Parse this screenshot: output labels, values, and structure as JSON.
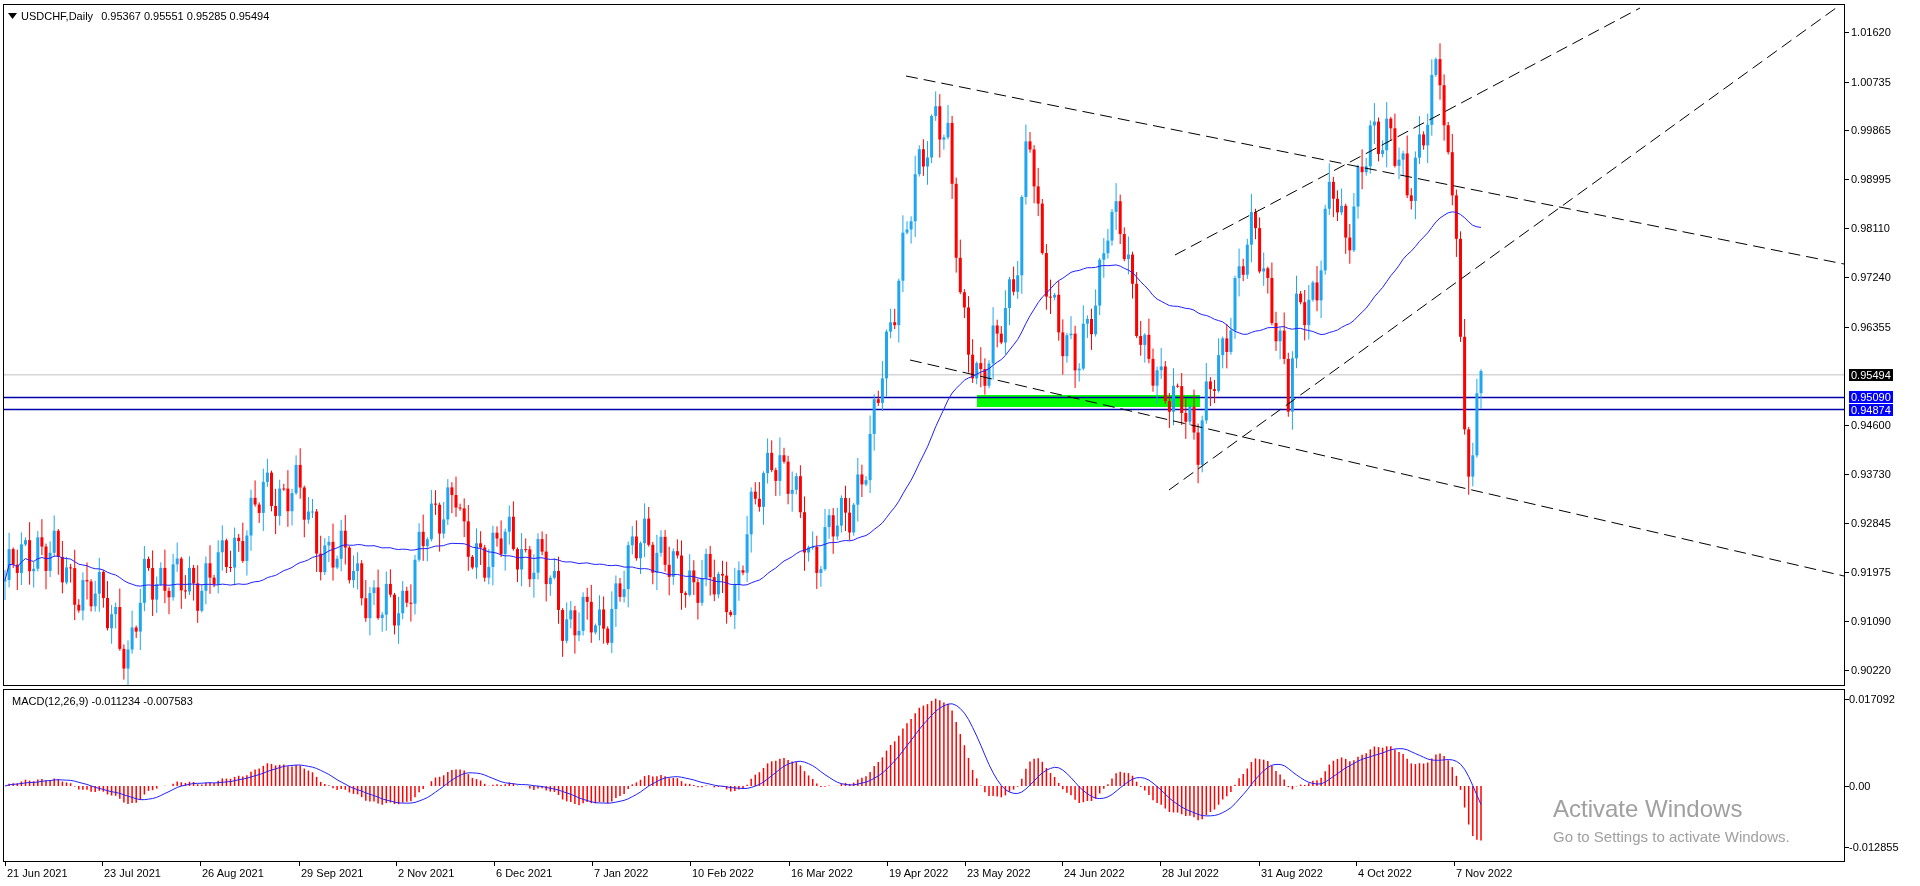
{
  "chart_header": {
    "symbol": "USDCHF,Daily",
    "ohlc": "0.95367 0.95551 0.95285 0.95494"
  },
  "price_axis": [
    "1.01620",
    "1.00735",
    "0.99865",
    "0.98995",
    "0.98110",
    "0.97240",
    "0.96355",
    "0.94600",
    "0.93730",
    "0.92845",
    "0.91975",
    "0.91090",
    "0.90220"
  ],
  "price_tags": [
    {
      "label": "0.95494",
      "kind": "current"
    },
    {
      "label": "0.95090",
      "kind": "level"
    },
    {
      "label": "0.94874",
      "kind": "level"
    }
  ],
  "indicator": {
    "title": "MACD(12,26,9) -0.011234 -0.007583",
    "axis": [
      "0.017092",
      "0.00",
      "-0.012855"
    ]
  },
  "date_axis": [
    "21 Jun 2021",
    "23 Jul 2021",
    "26 Aug 2021",
    "29 Sep 2021",
    "2 Nov 2021",
    "6 Dec 2021",
    "7 Jan 2022",
    "10 Feb 2022",
    "16 Mar 2022",
    "19 Apr 2022",
    "23 May 2022",
    "24 Jun 2022",
    "28 Jul 2022",
    "31 Aug 2022",
    "4 Oct 2022",
    "7 Nov 2022"
  ],
  "activation_notice": {
    "title": "Activate Windows",
    "subtitle": "Go to Settings to activate Windows."
  }
}
